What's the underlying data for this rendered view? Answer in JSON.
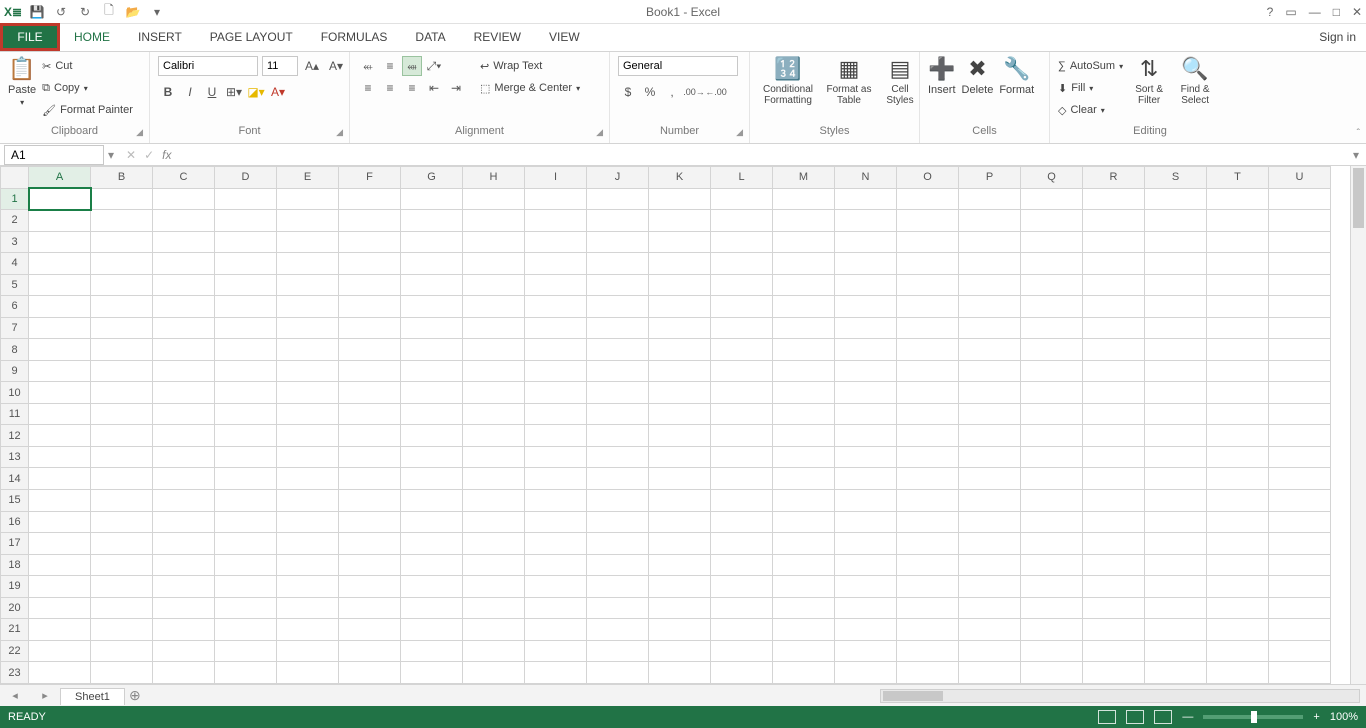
{
  "title": "Book1 - Excel",
  "qat_dropdown": "▾",
  "win": {
    "help": "?",
    "restore": "▭",
    "min": "—",
    "max": "□",
    "close": "✕"
  },
  "tabs": {
    "file": "FILE",
    "home": "HOME",
    "insert": "INSERT",
    "pagelayout": "PAGE LAYOUT",
    "formulas": "FORMULAS",
    "data": "DATA",
    "review": "REVIEW",
    "view": "VIEW"
  },
  "signin": "Sign in",
  "clipboard": {
    "paste": "Paste",
    "cut": "Cut",
    "copy": "Copy",
    "formatpainter": "Format Painter",
    "label": "Clipboard"
  },
  "font": {
    "name": "Calibri",
    "size": "11",
    "bold": "B",
    "italic": "I",
    "underline": "U",
    "label": "Font"
  },
  "alignment": {
    "wrap": "Wrap Text",
    "merge": "Merge & Center",
    "label": "Alignment"
  },
  "number": {
    "format": "General",
    "label": "Number",
    "currency": "$",
    "percent": "%",
    "comma": ",",
    "inc": "←.0",
    "dec": ".00→"
  },
  "styles": {
    "cond": "Conditional Formatting",
    "table": "Format as Table",
    "cell": "Cell Styles",
    "label": "Styles"
  },
  "cells": {
    "insert": "Insert",
    "delete": "Delete",
    "format": "Format",
    "label": "Cells"
  },
  "editing": {
    "autosum": "AutoSum",
    "fill": "Fill",
    "clear": "Clear",
    "sort": "Sort & Filter",
    "find": "Find & Select",
    "label": "Editing"
  },
  "namebox": "A1",
  "fx": "fx",
  "columns": [
    "A",
    "B",
    "C",
    "D",
    "E",
    "F",
    "G",
    "H",
    "I",
    "J",
    "K",
    "L",
    "M",
    "N",
    "O",
    "P",
    "Q",
    "R",
    "S",
    "T",
    "U"
  ],
  "rows": [
    "1",
    "2",
    "3",
    "4",
    "5",
    "6",
    "7",
    "8",
    "9",
    "10",
    "11",
    "12",
    "13",
    "14",
    "15",
    "16",
    "17",
    "18",
    "19",
    "20",
    "21",
    "22",
    "23"
  ],
  "sheet_tab": "Sheet1",
  "status": "READY",
  "zoom": "100%"
}
